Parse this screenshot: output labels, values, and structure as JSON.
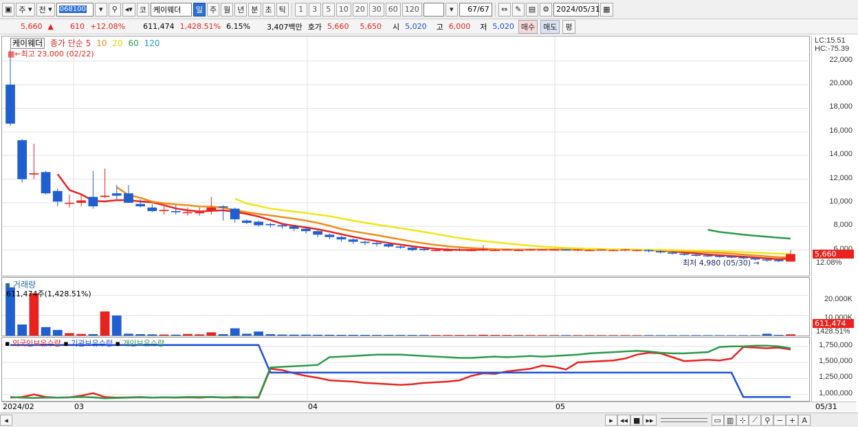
{
  "toolbar": {
    "market": "주",
    "prev_label": "전",
    "code": "068100",
    "code_prefix": "코",
    "name": "케이웨더",
    "periods": [
      "일",
      "주",
      "월",
      "년",
      "분",
      "초",
      "틱"
    ],
    "numbers": [
      "1",
      "3",
      "5",
      "10",
      "20",
      "30",
      "60",
      "120"
    ],
    "count": "67",
    "total": "/67",
    "date": "2024/05/31"
  },
  "info": {
    "price": "5,660",
    "change": "610",
    "change_pct": "+12.08%",
    "volume": "611,474",
    "volume_ratio": "1,428.51%",
    "turnover_rate": "6.15%",
    "amount": "3,407백만",
    "quote_label": "호가",
    "ask": "5,660",
    "bid": "5,650",
    "open_label": "시",
    "open": "5,020",
    "high_label": "고",
    "high": "6,000",
    "low_label": "저",
    "low": "5,020",
    "buy_label": "매수",
    "sell_label": "매도",
    "avg_label": "평"
  },
  "price_panel": {
    "stock_name": "케이웨더",
    "ma_title": "종가 단순 5",
    "ma_periods": [
      "10",
      "20",
      "60",
      "120"
    ],
    "ma_colors": [
      "#e8231f",
      "#f08c1a",
      "#f0e614",
      "#2a9a4a",
      "#1f9ad8"
    ],
    "high_note": "최고 23,000 (02/22)",
    "low_note": "최저 4,980 (05/30)",
    "lc": "LC:15.51",
    "hc": "HC:-75.39",
    "y_ticks": [
      "22,000",
      "20,000",
      "18,000",
      "16,000",
      "14,000",
      "12,000",
      "10,000",
      "8,000",
      "6,000"
    ],
    "last_price_tag": "5,660",
    "last_pct_tag": "12.08%"
  },
  "volume_panel": {
    "title": "거래량",
    "value_note": "611,474주(1,428.51%)",
    "y_ticks": [
      "20,000K",
      "10,000K"
    ],
    "last_tag": "611,474",
    "last_pct": "1428.51%"
  },
  "holding_panel": {
    "legend": [
      "외국인보유수량",
      "기관보유수량",
      "개인보유수량"
    ],
    "legend_colors": [
      "#e8231f",
      "#1f4fd8",
      "#2a9a4a"
    ],
    "y_ticks": [
      "1,750,000",
      "1,500,000",
      "1,250,000",
      "1,000,000"
    ]
  },
  "x_axis": {
    "labels": [
      "2024/02",
      "03",
      "04",
      "05"
    ],
    "end_label": "05/31"
  },
  "chart_data": [
    {
      "type": "candlestick",
      "title": "케이웨더",
      "x": [
        "02/22",
        "02/23",
        "02/26",
        "02/27",
        "02/28",
        "02/29",
        "03/04",
        "03/05",
        "03/06",
        "03/07",
        "03/08",
        "03/11",
        "03/12",
        "03/13",
        "03/14",
        "03/15",
        "03/18",
        "03/19",
        "03/20",
        "03/21",
        "03/22",
        "03/25",
        "03/26",
        "03/27",
        "03/28",
        "03/29",
        "04/01",
        "04/02",
        "04/03",
        "04/04",
        "04/05",
        "04/08",
        "04/09",
        "04/11",
        "04/12",
        "04/15",
        "04/16",
        "04/17",
        "04/18",
        "04/19",
        "04/22",
        "04/23",
        "04/24",
        "04/25",
        "04/26",
        "04/29",
        "04/30",
        "05/02",
        "05/03",
        "05/07",
        "05/08",
        "05/09",
        "05/10",
        "05/13",
        "05/14",
        "05/16",
        "05/17",
        "05/20",
        "05/21",
        "05/22",
        "05/23",
        "05/24",
        "05/27",
        "05/28",
        "05/29",
        "05/30",
        "05/31"
      ],
      "open": [
        20000,
        15300,
        12400,
        12600,
        11000,
        10000,
        10000,
        10500,
        10500,
        10800,
        10800,
        9900,
        9600,
        9300,
        9300,
        9200,
        9200,
        9300,
        9700,
        9500,
        8500,
        8400,
        8200,
        8100,
        8000,
        7800,
        7600,
        7300,
        7100,
        6900,
        6700,
        6600,
        6500,
        6300,
        6200,
        6100,
        6000,
        6000,
        6000,
        6000,
        6050,
        6000,
        6000,
        6000,
        6000,
        6050,
        6050,
        6050,
        6000,
        6000,
        6000,
        6000,
        6000,
        6000,
        6000,
        5900,
        5800,
        5700,
        5600,
        5550,
        5500,
        5450,
        5400,
        5300,
        5200,
        5150,
        5020
      ],
      "high": [
        23000,
        15400,
        15000,
        12700,
        11200,
        10700,
        10700,
        12700,
        12900,
        11500,
        11500,
        10300,
        9900,
        9700,
        9800,
        9600,
        9600,
        10500,
        9800,
        9600,
        8600,
        8500,
        8300,
        8200,
        8100,
        7900,
        7700,
        7400,
        7200,
        7000,
        6800,
        6700,
        6600,
        6400,
        6300,
        6200,
        6100,
        6200,
        6150,
        6100,
        6400,
        6100,
        6100,
        6100,
        6100,
        6100,
        6100,
        6100,
        6100,
        6050,
        6050,
        6050,
        6100,
        6050,
        6050,
        6000,
        5900,
        5800,
        5700,
        5650,
        5600,
        5550,
        5500,
        5400,
        5300,
        5250,
        6000
      ],
      "low": [
        16500,
        11700,
        12000,
        10700,
        9700,
        9600,
        9700,
        9500,
        10400,
        10300,
        10000,
        9600,
        9200,
        9000,
        9000,
        8900,
        8900,
        9000,
        8500,
        8300,
        8200,
        8000,
        7900,
        7800,
        7600,
        7400,
        7100,
        6900,
        6700,
        6500,
        6400,
        6300,
        6200,
        6100,
        5900,
        5900,
        5900,
        5900,
        5900,
        5900,
        5900,
        5950,
        5950,
        5950,
        5950,
        5950,
        5950,
        5950,
        5900,
        5950,
        5950,
        5900,
        5900,
        5900,
        5800,
        5700,
        5600,
        5500,
        5450,
        5400,
        5350,
        5300,
        5200,
        5100,
        5000,
        4980,
        5020
      ],
      "close": [
        16700,
        12000,
        12500,
        10800,
        10100,
        10000,
        10200,
        9700,
        10600,
        10600,
        10000,
        9700,
        9300,
        9400,
        9200,
        9200,
        9200,
        9600,
        9600,
        8600,
        8300,
        8100,
        8100,
        8000,
        7800,
        7600,
        7300,
        7100,
        6900,
        6700,
        6600,
        6500,
        6300,
        6200,
        6000,
        6000,
        6000,
        6000,
        6050,
        6000,
        6100,
        6000,
        6050,
        6000,
        6050,
        6050,
        6050,
        6000,
        6050,
        6000,
        6050,
        6000,
        6050,
        6000,
        5900,
        5800,
        5700,
        5600,
        5550,
        5500,
        5450,
        5400,
        5300,
        5200,
        5150,
        5050,
        5660
      ]
    },
    {
      "type": "bar",
      "title": "거래량",
      "values_k": [
        24000,
        5500,
        21000,
        4200,
        2800,
        1200,
        800,
        700,
        12000,
        10000,
        900,
        700,
        600,
        500,
        450,
        800,
        600,
        1600,
        700,
        3600,
        900,
        2000,
        700,
        500,
        450,
        450,
        400,
        380,
        350,
        350,
        330,
        300,
        300,
        290,
        280,
        280,
        270,
        270,
        280,
        260,
        400,
        300,
        280,
        250,
        240,
        230,
        230,
        220,
        220,
        210,
        210,
        200,
        220,
        200,
        210,
        200,
        190,
        190,
        180,
        180,
        170,
        170,
        180,
        170,
        900,
        300,
        611
      ]
    },
    {
      "type": "line",
      "title": "보유수량",
      "series": [
        {
          "name": "외국인보유수량",
          "values": [
            950000,
            960000,
            1000000,
            960000,
            950000,
            955000,
            980000,
            1020000,
            960000,
            950000,
            955000,
            960000,
            950000,
            955000,
            950000,
            955000,
            950000,
            960000,
            950000,
            960000,
            955000,
            950000,
            1400000,
            1380000,
            1330000,
            1290000,
            1260000,
            1220000,
            1210000,
            1200000,
            1180000,
            1170000,
            1160000,
            1150000,
            1160000,
            1180000,
            1190000,
            1200000,
            1220000,
            1290000,
            1330000,
            1320000,
            1360000,
            1380000,
            1400000,
            1450000,
            1430000,
            1390000,
            1500000,
            1510000,
            1520000,
            1530000,
            1560000,
            1620000,
            1650000,
            1640000,
            1580000,
            1520000,
            1530000,
            1540000,
            1530000,
            1560000,
            1740000,
            1730000,
            1720000,
            1730000,
            1700000
          ]
        },
        {
          "name": "기관보유수량",
          "values": [
            1770000,
            1770000,
            1770000,
            1770000,
            1770000,
            1770000,
            1770000,
            1770000,
            1770000,
            1770000,
            1770000,
            1770000,
            1770000,
            1770000,
            1770000,
            1770000,
            1770000,
            1770000,
            1770000,
            1770000,
            1770000,
            1770000,
            1340000,
            1340000,
            1340000,
            1340000,
            1340000,
            1340000,
            1340000,
            1340000,
            1340000,
            1340000,
            1340000,
            1340000,
            1340000,
            1340000,
            1340000,
            1340000,
            1340000,
            1340000,
            1340000,
            1340000,
            1340000,
            1340000,
            1340000,
            1340000,
            1340000,
            1340000,
            1340000,
            1340000,
            1340000,
            1340000,
            1340000,
            1340000,
            1340000,
            1340000,
            1340000,
            1340000,
            1340000,
            1340000,
            1340000,
            1340000,
            960000,
            960000,
            960000,
            960000,
            960000
          ]
        },
        {
          "name": "개인보유수량",
          "values": [
            960000,
            950000,
            945000,
            950000,
            950000,
            955000,
            960000,
            955000,
            940000,
            945000,
            950000,
            955000,
            950000,
            955000,
            955000,
            960000,
            960000,
            960000,
            955000,
            950000,
            955000,
            960000,
            1420000,
            1430000,
            1440000,
            1450000,
            1460000,
            1580000,
            1590000,
            1600000,
            1610000,
            1620000,
            1620000,
            1620000,
            1610000,
            1600000,
            1590000,
            1580000,
            1570000,
            1570000,
            1580000,
            1590000,
            1580000,
            1590000,
            1600000,
            1590000,
            1600000,
            1610000,
            1620000,
            1640000,
            1650000,
            1660000,
            1670000,
            1680000,
            1670000,
            1650000,
            1640000,
            1640000,
            1650000,
            1660000,
            1740000,
            1750000,
            1750000,
            1760000,
            1760000,
            1750000,
            1720000
          ]
        }
      ]
    }
  ]
}
